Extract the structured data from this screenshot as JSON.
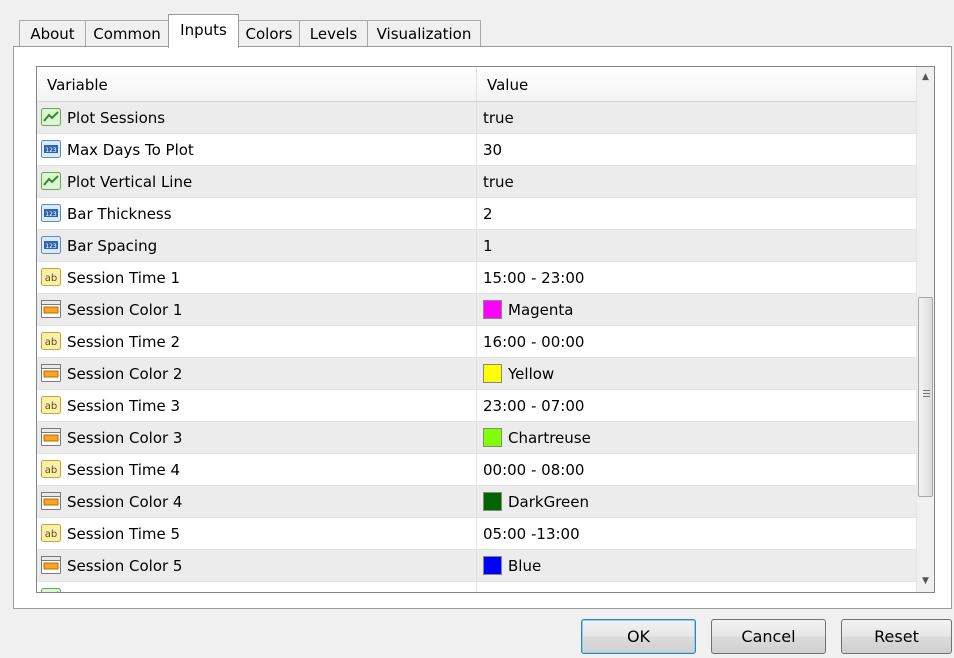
{
  "tabs": [
    "About",
    "Common",
    "Inputs",
    "Colors",
    "Levels",
    "Visualization"
  ],
  "active_tab": "Inputs",
  "grid": {
    "col_variable": "Variable",
    "col_value": "Value",
    "rows": [
      {
        "icon": "bool-icon",
        "name": "Plot Sessions",
        "value": "true"
      },
      {
        "icon": "number-icon",
        "name": "Max Days To Plot",
        "value": "30"
      },
      {
        "icon": "bool-icon",
        "name": "Plot Vertical Line",
        "value": "true"
      },
      {
        "icon": "number-icon",
        "name": "Bar Thickness",
        "value": "2"
      },
      {
        "icon": "number-icon",
        "name": "Bar Spacing",
        "value": "1"
      },
      {
        "icon": "string-icon",
        "name": "Session Time 1",
        "value": "15:00 - 23:00"
      },
      {
        "icon": "color-icon",
        "name": "Session Color 1",
        "value": "Magenta",
        "swatch": "#ff00ff"
      },
      {
        "icon": "string-icon",
        "name": "Session Time 2",
        "value": "16:00 - 00:00"
      },
      {
        "icon": "color-icon",
        "name": "Session Color 2",
        "value": "Yellow",
        "swatch": "#ffff00"
      },
      {
        "icon": "string-icon",
        "name": "Session Time 3",
        "value": "23:00 - 07:00"
      },
      {
        "icon": "color-icon",
        "name": "Session Color 3",
        "value": "Chartreuse",
        "swatch": "#7fff00"
      },
      {
        "icon": "string-icon",
        "name": "Session Time 4",
        "value": "00:00 - 08:00"
      },
      {
        "icon": "color-icon",
        "name": "Session Color 4",
        "value": "DarkGreen",
        "swatch": "#006400"
      },
      {
        "icon": "string-icon",
        "name": "Session Time 5",
        "value": "05:00 -13:00"
      },
      {
        "icon": "color-icon",
        "name": "Session Color 5",
        "value": "Blue",
        "swatch": "#0000ff"
      }
    ]
  },
  "buttons": {
    "ok": "OK",
    "cancel": "Cancel",
    "reset": "Reset"
  }
}
